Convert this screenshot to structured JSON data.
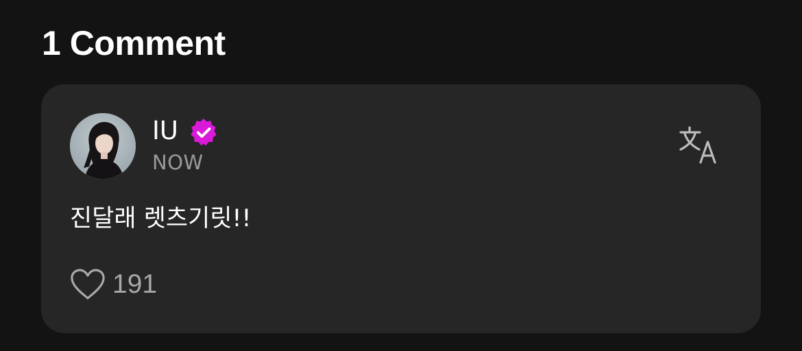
{
  "section": {
    "title": "1 Comment"
  },
  "comment": {
    "author": {
      "name": "IU",
      "verified_icon": "verified-badge-icon",
      "avatar_icon": "avatar"
    },
    "timestamp": "NOW",
    "text": "진달래 렛츠기릿!!",
    "translate_icon": "translate-icon",
    "likes": {
      "icon": "heart-icon",
      "count": "191"
    }
  },
  "colors": {
    "background": "#131313",
    "card": "#262626",
    "verified_badge": "#d91ad9",
    "secondary_text": "#9a9a9a"
  }
}
